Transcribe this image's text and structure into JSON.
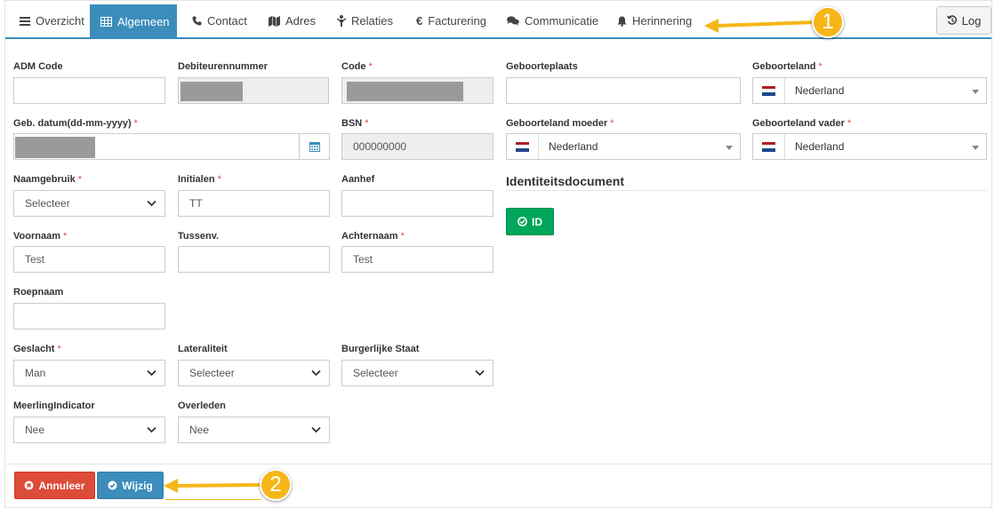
{
  "tabs": [
    {
      "label": "Overzicht",
      "icon": "list-icon",
      "active": false
    },
    {
      "label": "Algemeen",
      "icon": "table-icon",
      "active": true
    },
    {
      "label": "Contact",
      "icon": "phone-icon",
      "active": false
    },
    {
      "label": "Adres",
      "icon": "map-icon",
      "active": false
    },
    {
      "label": "Relaties",
      "icon": "people-icon",
      "active": false
    },
    {
      "label": "Facturering",
      "icon": "euro-icon",
      "active": false
    },
    {
      "label": "Communicatie",
      "icon": "comments-icon",
      "active": false
    },
    {
      "label": "Herinnering",
      "icon": "bell-icon",
      "active": false
    }
  ],
  "log_button": "Log",
  "fields": {
    "adm_code": {
      "label": "ADM Code",
      "value": ""
    },
    "debiteurennummer": {
      "label": "Debiteurennummer",
      "value": ""
    },
    "code": {
      "label": "Code",
      "value": ""
    },
    "geb_datum": {
      "label": "Geb. datum(dd-mm-yyyy)",
      "value": ""
    },
    "bsn": {
      "label": "BSN",
      "value": "000000000"
    },
    "naamgebruik": {
      "label": "Naamgebruik",
      "value": "Selecteer"
    },
    "initialen": {
      "label": "Initialen",
      "value": "TT"
    },
    "aanhef": {
      "label": "Aanhef",
      "value": ""
    },
    "voornaam": {
      "label": "Voornaam",
      "value": "Test"
    },
    "tussenv": {
      "label": "Tussenv.",
      "value": ""
    },
    "achternaam": {
      "label": "Achternaam",
      "value": "Test"
    },
    "roepnaam": {
      "label": "Roepnaam",
      "value": ""
    },
    "geslacht": {
      "label": "Geslacht",
      "value": "Man"
    },
    "lateraliteit": {
      "label": "Lateraliteit",
      "value": "Selecteer"
    },
    "burgerlijke_staat": {
      "label": "Burgerlijke Staat",
      "value": "Selecteer"
    },
    "meerling": {
      "label": "MeerlingIndicator",
      "value": "Nee"
    },
    "overleden": {
      "label": "Overleden",
      "value": "Nee"
    },
    "geboorteplaats": {
      "label": "Geboorteplaats",
      "value": ""
    },
    "geboorteland": {
      "label": "Geboorteland",
      "value": "Nederland"
    },
    "geboorteland_moeder": {
      "label": "Geboorteland moeder",
      "value": "Nederland"
    },
    "geboorteland_vader": {
      "label": "Geboorteland vader",
      "value": "Nederland"
    }
  },
  "required_marker": "*",
  "identity": {
    "title": "Identiteitsdocument",
    "button": "ID"
  },
  "actions": {
    "cancel": "Annuleer",
    "save": "Wijzig"
  },
  "callouts": [
    "1",
    "2"
  ],
  "colors": {
    "primary": "#3c8dbc",
    "danger": "#dd4b39",
    "success": "#00a65a",
    "callout": "#f6b617"
  }
}
